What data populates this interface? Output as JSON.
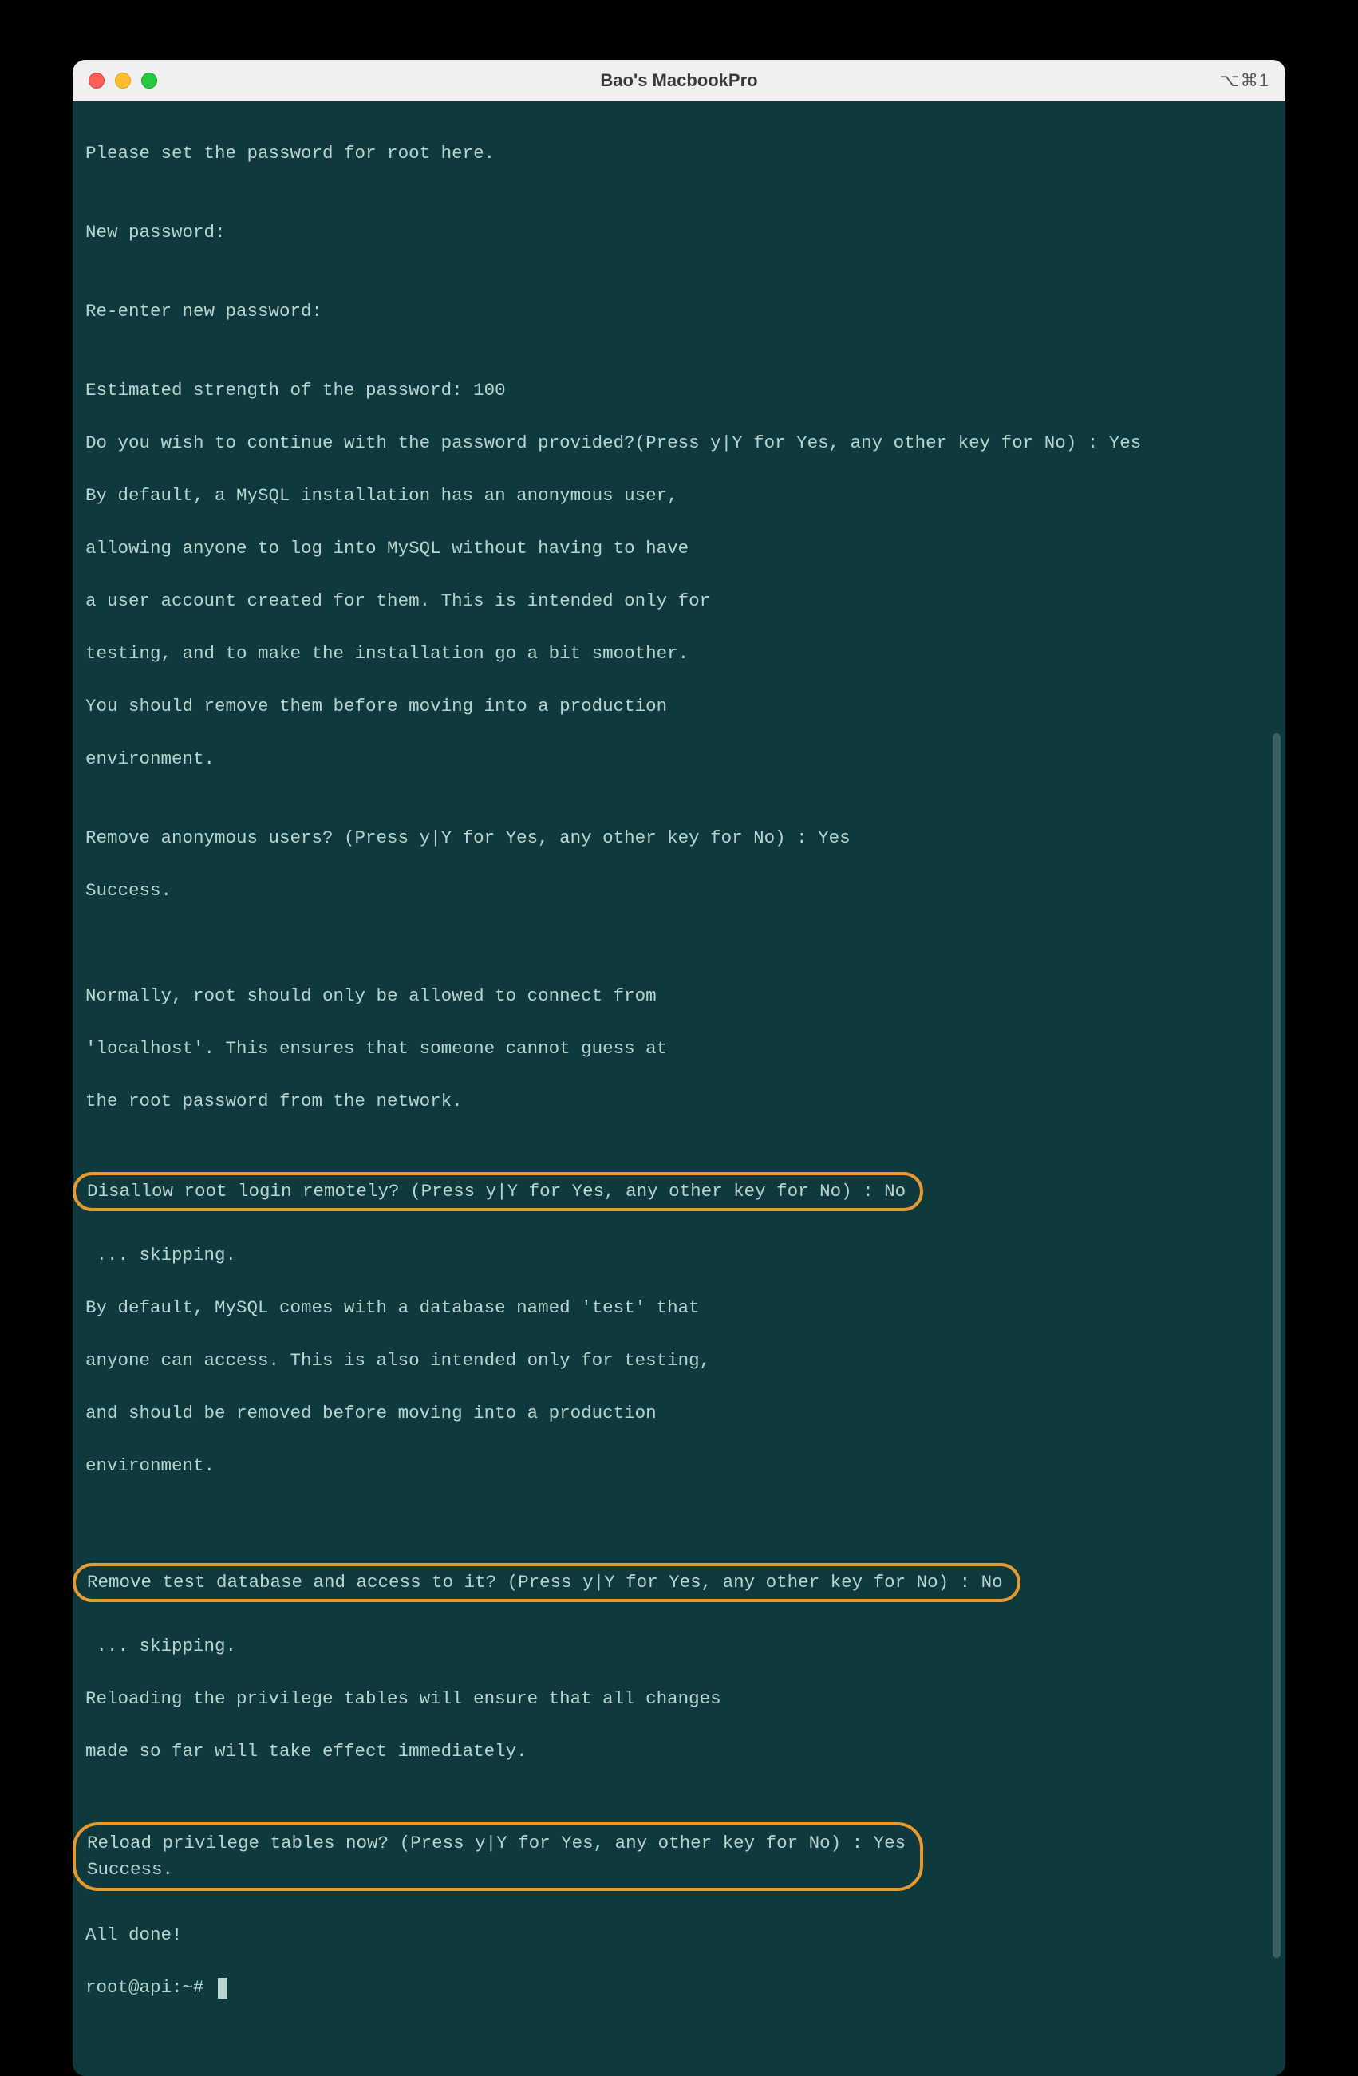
{
  "window": {
    "title": "Bao's MacbookPro",
    "shortcut_label": "⌥⌘1"
  },
  "terminal": {
    "lines": {
      "l00": "Please set the password for root here.",
      "l01": "",
      "l02": "New password:",
      "l03": "",
      "l04": "Re-enter new password:",
      "l05": "",
      "l06": "Estimated strength of the password: 100",
      "l07": "Do you wish to continue with the password provided?(Press y|Y for Yes, any other key for No) : Yes",
      "l08": "By default, a MySQL installation has an anonymous user,",
      "l09": "allowing anyone to log into MySQL without having to have",
      "l10": "a user account created for them. This is intended only for",
      "l11": "testing, and to make the installation go a bit smoother.",
      "l12": "You should remove them before moving into a production",
      "l13": "environment.",
      "l14": "",
      "l15": "Remove anonymous users? (Press y|Y for Yes, any other key for No) : Yes",
      "l16": "Success.",
      "l17": "",
      "l18": "",
      "l19": "Normally, root should only be allowed to connect from",
      "l20": "'localhost'. This ensures that someone cannot guess at",
      "l21": "the root password from the network.",
      "l22": "",
      "l23": "Disallow root login remotely? (Press y|Y for Yes, any other key for No) : No",
      "l24": "",
      "l25": " ... skipping.",
      "l26": "By default, MySQL comes with a database named 'test' that",
      "l27": "anyone can access. This is also intended only for testing,",
      "l28": "and should be removed before moving into a production",
      "l29": "environment.",
      "l30": "",
      "l31": "",
      "l32": "Remove test database and access to it? (Press y|Y for Yes, any other key for No) : No",
      "l33": "",
      "l34": " ... skipping.",
      "l35": "Reloading the privilege tables will ensure that all changes",
      "l36": "made so far will take effect immediately.",
      "l37": "",
      "l38a": "Reload privilege tables now? (Press y|Y for Yes, any other key for No) : Yes",
      "l38b": "Success.",
      "l39": "",
      "l40": "All done!",
      "l41": "root@api:~# "
    }
  }
}
